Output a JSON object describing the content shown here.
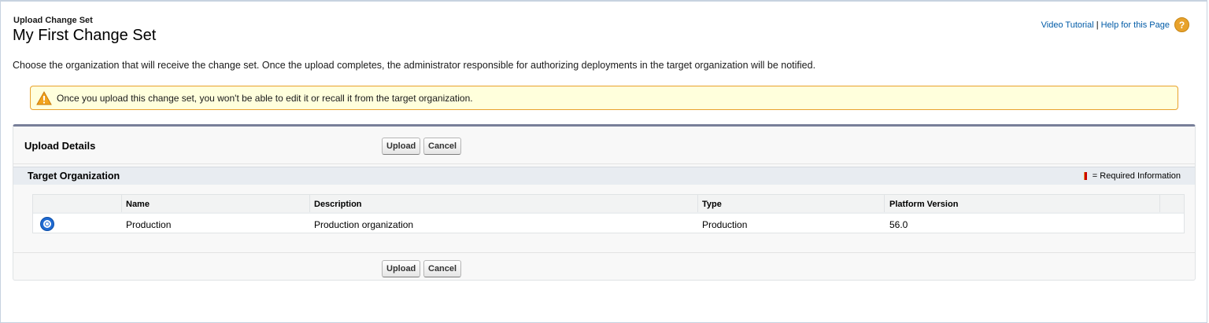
{
  "header": {
    "eyebrow": "Upload Change Set",
    "title": "My First Change Set",
    "video_tutorial": "Video Tutorial",
    "separator": "|",
    "help": "Help for this Page",
    "help_icon": "?"
  },
  "intro": "Choose the organization that will receive the change set. Once the upload completes, the administrator responsible for authorizing deployments in the target organization will be notified.",
  "warning": {
    "icon": "warning-triangle-icon",
    "text": "Once you upload this change set, you won't be able to edit it or recall it from the target organization."
  },
  "panel": {
    "title": "Upload Details",
    "upload_label": "Upload",
    "cancel_label": "Cancel",
    "section_title": "Target Organization",
    "required_text": "= Required Information"
  },
  "table": {
    "columns": [
      "Name",
      "Description",
      "Type",
      "Platform Version"
    ],
    "rows": [
      {
        "selected": true,
        "name": "Production",
        "description": "Production organization",
        "type": "Production",
        "platform_version": "56.0"
      }
    ]
  },
  "colors": {
    "link": "#015ba7",
    "warning_bg": "#ffffdc",
    "warning_border": "#e8a22c",
    "panel_border_top": "#787f99"
  }
}
